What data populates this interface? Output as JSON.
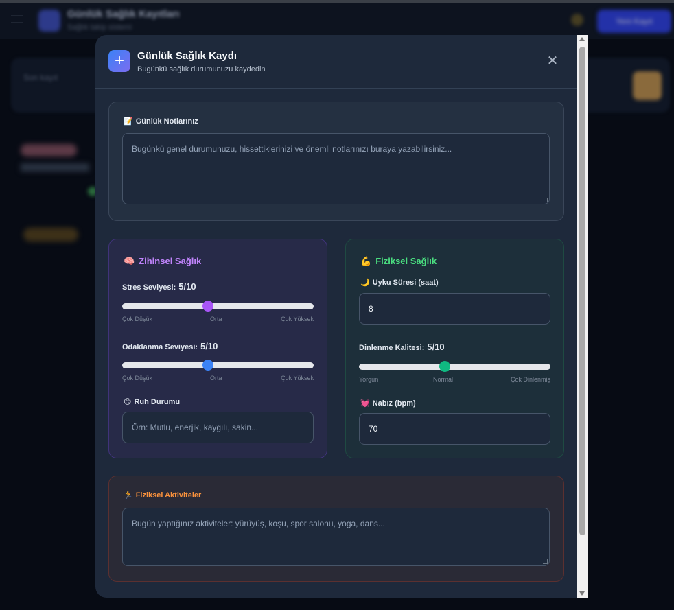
{
  "background_app": {
    "title": "Günlük Sağlık Kayıtları",
    "subtitle": "Sağlık takip sistemi",
    "action_button": "Yeni Kayıt",
    "card_text": "Son kayıt"
  },
  "modal": {
    "title": "Günlük Sağlık Kaydı",
    "subtitle": "Bugünkü sağlık durumunuzu kaydedin",
    "add_icon": "plus-icon",
    "close_icon": "close-icon",
    "close_symbol": "✕"
  },
  "notes": {
    "emoji": "📝",
    "label": "Günlük Notlarınız",
    "placeholder": "Bugünkü genel durumunuzu, hissettiklerinizi ve önemli notlarınızı buraya yazabilirsiniz..."
  },
  "mental": {
    "emoji": "🧠",
    "title": "Zihinsel Sağlık",
    "title_color": "#c084fc",
    "stress": {
      "label": "Stres Seviyesi:",
      "value_text": "5/10",
      "value": 5,
      "max": 10,
      "thumb_color": "#a855f7",
      "scale": [
        "Çok Düşük",
        "Orta",
        "Çok Yüksek"
      ]
    },
    "focus": {
      "label": "Odaklanma Seviyesi:",
      "value_text": "5/10",
      "value": 5,
      "max": 10,
      "thumb_color": "#3b82f6",
      "scale": [
        "Çok Düşük",
        "Orta",
        "Çok Yüksek"
      ]
    },
    "mood": {
      "emoji": "😊",
      "label": "Ruh Durumu",
      "placeholder": "Örn: Mutlu, enerjik, kaygılı, sakin..."
    }
  },
  "physical": {
    "emoji": "💪",
    "title": "Fiziksel Sağlık",
    "title_color": "#4ade80",
    "sleep": {
      "emoji": "🌙",
      "label": "Uyku Süresi (saat)",
      "value": "8"
    },
    "rest": {
      "label": "Dinlenme Kalitesi:",
      "value_text": "5/10",
      "value": 5,
      "max": 10,
      "thumb_color": "#10b981",
      "scale": [
        "Yorgun",
        "Normal",
        "Çok Dinlenmiş"
      ]
    },
    "pulse": {
      "emoji": "💓",
      "label": "Nabız (bpm)",
      "value": "70"
    }
  },
  "activity": {
    "emoji": "🏃",
    "label": "Fiziksel Aktiviteler",
    "label_color": "#fb923c",
    "placeholder": "Bugün yaptığınız aktiviteler: yürüyüş, koşu, spor salonu, yoga, dans..."
  }
}
